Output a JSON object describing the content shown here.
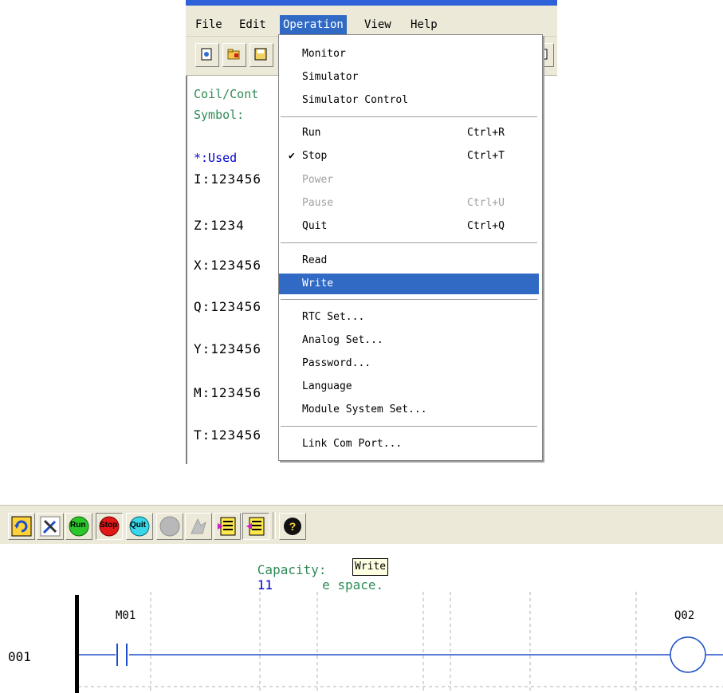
{
  "menubar": {
    "file": "File",
    "edit": "Edit",
    "operation": "Operation",
    "view": "View",
    "help": "Help"
  },
  "left_panel": {
    "coil_contact": "Coil/Cont",
    "symbol": "Symbol:",
    "used": "*:Used",
    "rows": [
      "I:123456",
      "Z:1234",
      "X:123456",
      "Q:123456",
      "Y:123456",
      "M:123456",
      "T:123456"
    ]
  },
  "operation_menu": {
    "monitor": "Monitor",
    "simulator": "Simulator",
    "simulator_control": "Simulator Control",
    "run": "Run",
    "run_shortcut": "Ctrl+R",
    "stop": "Stop",
    "stop_shortcut": "Ctrl+T",
    "power": "Power",
    "pause": "Pause",
    "pause_shortcut": "Ctrl+U",
    "quit": "Quit",
    "quit_shortcut": "Ctrl+Q",
    "read": "Read",
    "write": "Write",
    "rtc_set": "RTC Set...",
    "analog_set": "Analog Set...",
    "password": "Password...",
    "language": "Language",
    "module_system_set": "Module System Set...",
    "link_com_port": "Link Com Port..."
  },
  "bottom_toolbar": {
    "run_label": "Run",
    "stop_label": "Stop",
    "quit_label": "Quit"
  },
  "ladder": {
    "capacity_label": "Capacity:",
    "capacity_value": "11",
    "capacity_suffix": "e space.",
    "tooltip": "Write",
    "rung_number": "001",
    "contact_label": "M01",
    "coil_label": "Q02"
  }
}
